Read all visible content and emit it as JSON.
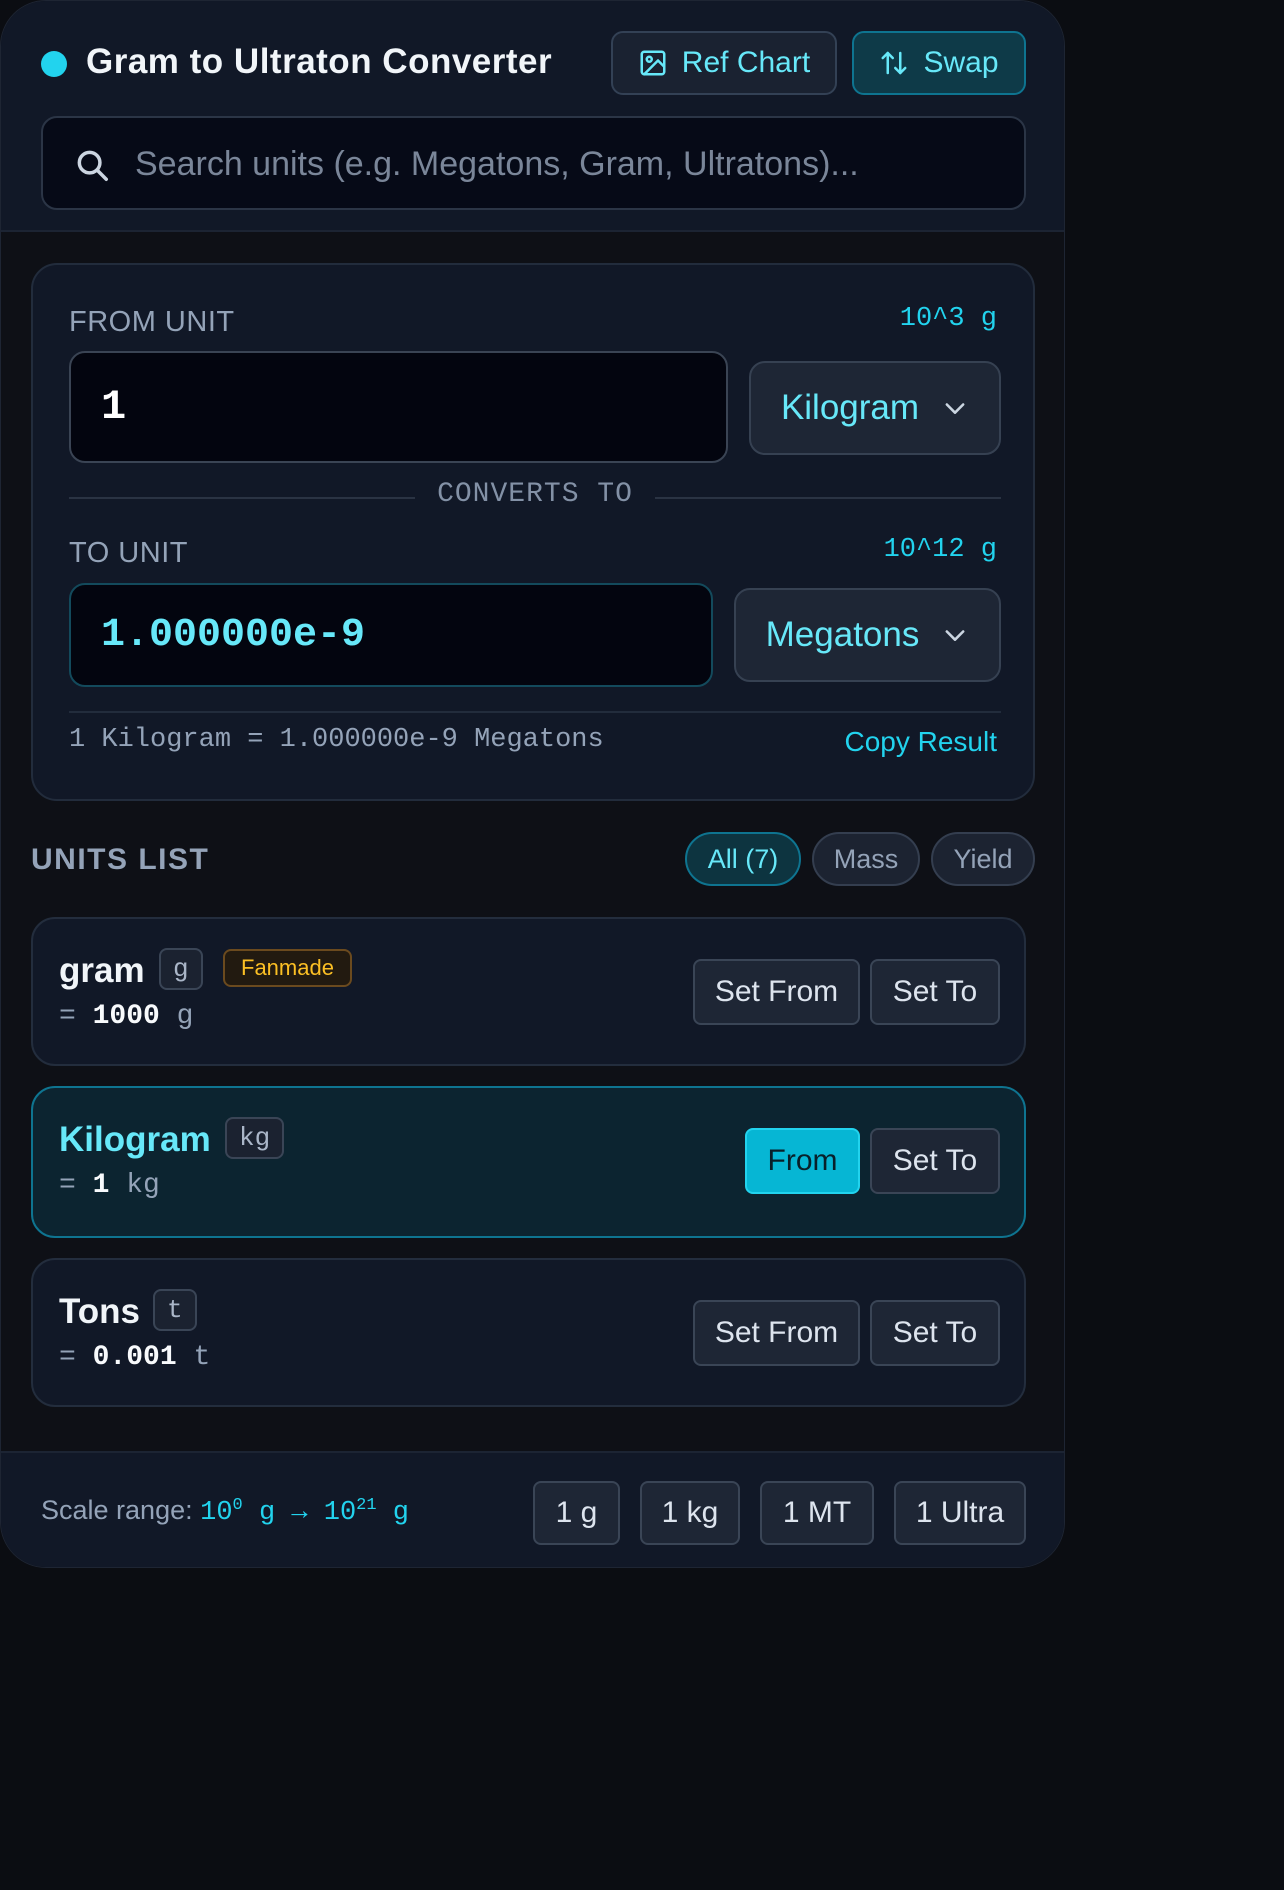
{
  "header": {
    "title": "Gram to Ultraton Converter",
    "ref_chart_label": "Ref Chart",
    "swap_label": "Swap",
    "search_placeholder": "Search units (e.g. Megatons, Gram, Ultratons)...",
    "search_value": ""
  },
  "converter": {
    "from_label": "FROM UNIT",
    "from_power": "10^3 g",
    "from_value": "1",
    "from_unit": "Kilogram",
    "divider": "CONVERTS TO",
    "to_label": "TO UNIT",
    "to_power": "10^12 g",
    "to_value": "1.000000e-9",
    "to_unit": "Megatons",
    "formula": "1 Kilogram = 1.000000e-9 Megatons",
    "copy_label": "Copy Result"
  },
  "units_list": {
    "title": "UNITS LIST",
    "filters": [
      "All (7)",
      "Mass",
      "Yield"
    ],
    "active_filter": "All (7)",
    "items": [
      {
        "name": "gram",
        "symbol": "g",
        "tag": "Fanmade",
        "eq_prefix": "=",
        "eq_value": "1000",
        "eq_unit": "g",
        "from_label": "Set From",
        "to_label": "Set To"
      },
      {
        "name": "Kilogram",
        "symbol": "kg",
        "eq_prefix": "=",
        "eq_value": "1",
        "eq_unit": "kg",
        "from_label": "From",
        "to_label": "Set To",
        "selected": true
      },
      {
        "name": "Tons",
        "symbol": "t",
        "eq_prefix": "=",
        "eq_value": "0.001",
        "eq_unit": "t",
        "from_label": "Set From",
        "to_label": "Set To"
      }
    ]
  },
  "footer": {
    "scale_label": "Scale range:",
    "scale_from_base": "10",
    "scale_from_exp": "0",
    "scale_unit": "g",
    "scale_arrow": "→",
    "scale_to_base": "10",
    "scale_to_exp": "21",
    "quick": [
      "1 g",
      "1 kg",
      "1 MT",
      "1 Ultra"
    ]
  },
  "colors": {
    "accent": "#22d3ee",
    "accent_light": "#67e8f9",
    "background": "#0e1016",
    "card": "#111827",
    "badge_amber": "#fbbf24"
  },
  "icons": [
    "status-dot",
    "image-icon",
    "swap-arrows-icon",
    "search-icon",
    "chevron-down-icon"
  ]
}
